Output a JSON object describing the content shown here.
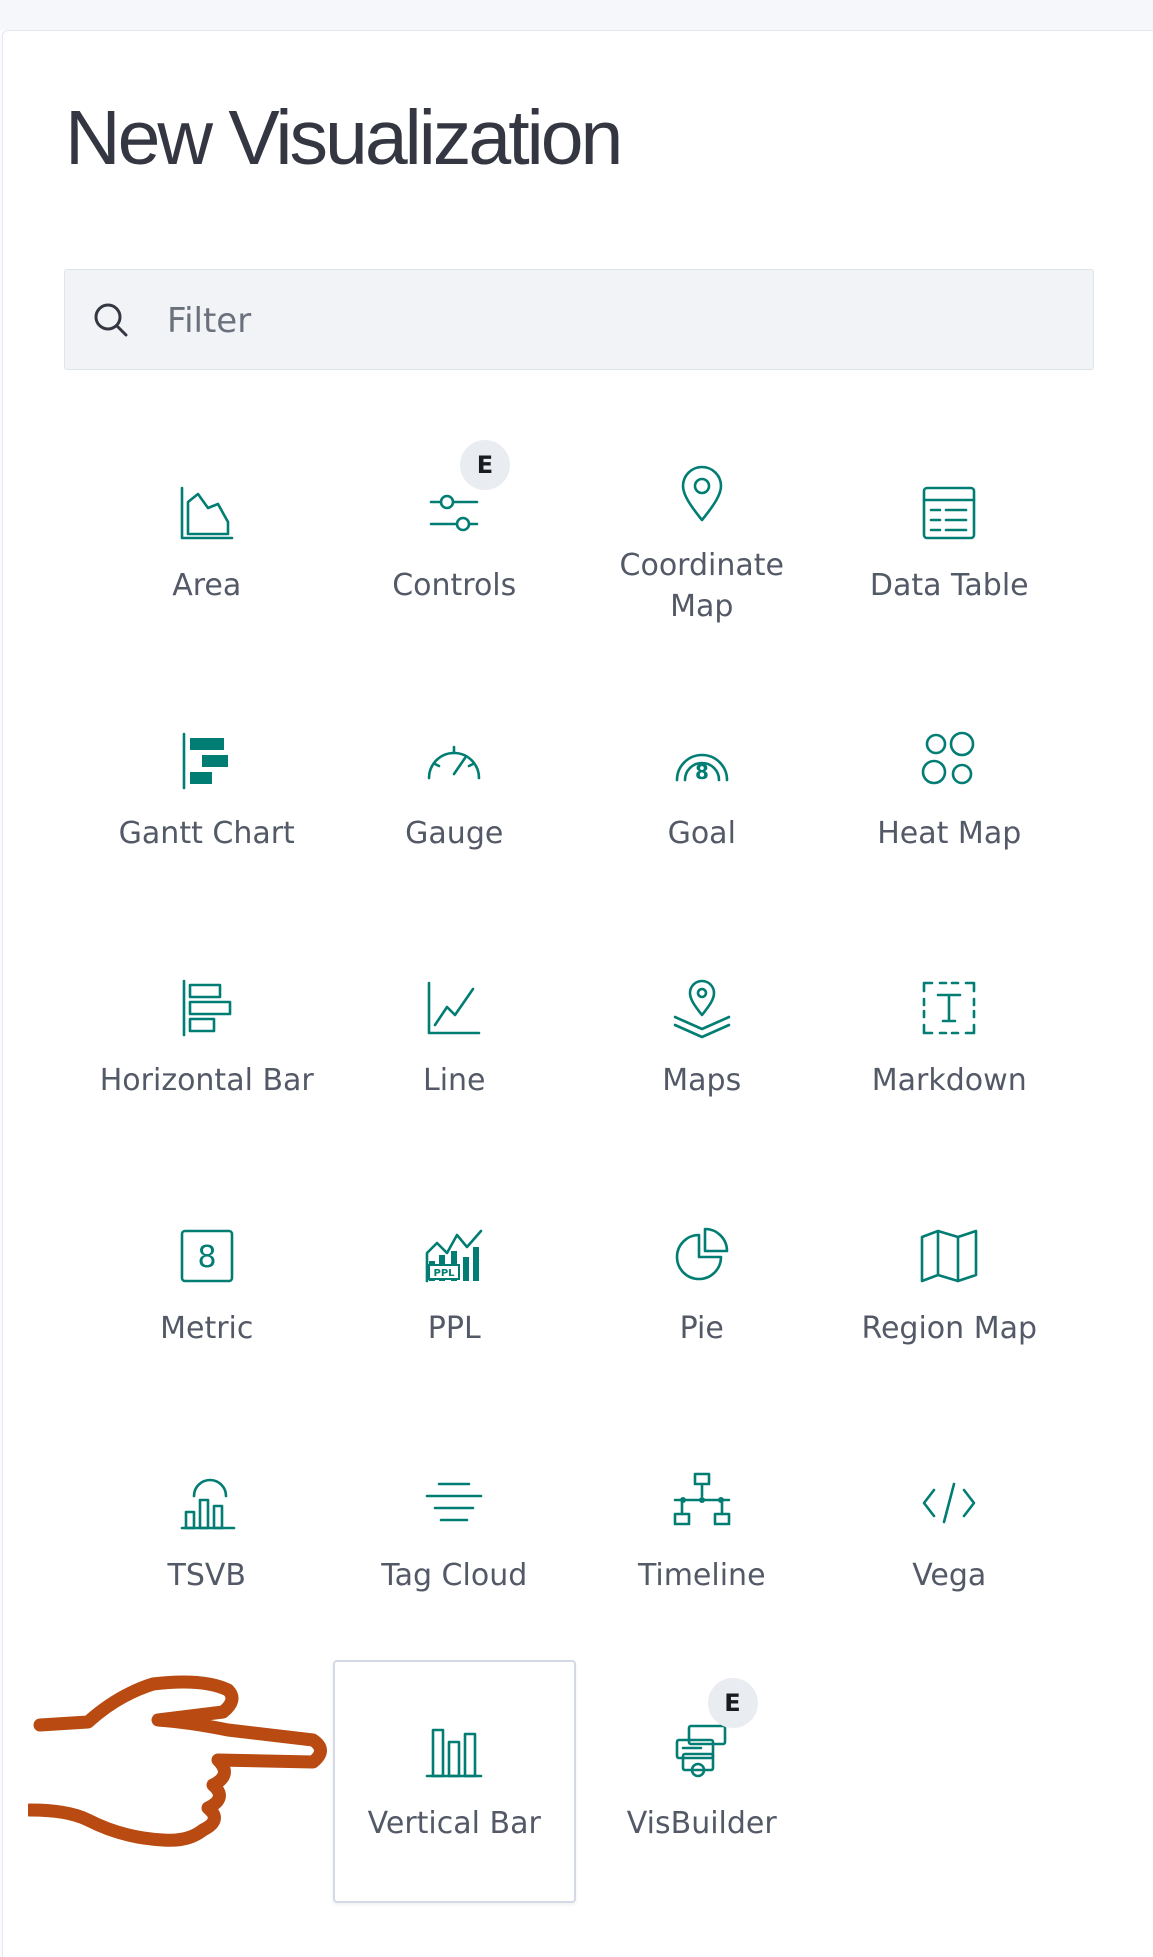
{
  "title": "New Visualization",
  "search": {
    "placeholder": "Filter",
    "value": ""
  },
  "colors": {
    "accent": "#017d73",
    "annotation": "#b84a12",
    "text": "#535966",
    "title": "#343741"
  },
  "visualizations": [
    {
      "label": "Area",
      "icon": "area-chart-icon"
    },
    {
      "label": "Controls",
      "icon": "controls-icon",
      "badge": "E"
    },
    {
      "label": "Coordinate\nMap",
      "icon": "map-pin-icon"
    },
    {
      "label": "Data Table",
      "icon": "table-icon"
    },
    {
      "label": "Gantt Chart",
      "icon": "gantt-chart-icon"
    },
    {
      "label": "Gauge",
      "icon": "gauge-icon"
    },
    {
      "label": "Goal",
      "icon": "goal-icon"
    },
    {
      "label": "Heat Map",
      "icon": "heat-map-icon"
    },
    {
      "label": "Horizontal Bar",
      "icon": "horizontal-bar-icon"
    },
    {
      "label": "Line",
      "icon": "line-chart-icon"
    },
    {
      "label": "Maps",
      "icon": "maps-icon"
    },
    {
      "label": "Markdown",
      "icon": "markdown-icon"
    },
    {
      "label": "Metric",
      "icon": "metric-icon"
    },
    {
      "label": "PPL",
      "icon": "ppl-icon"
    },
    {
      "label": "Pie",
      "icon": "pie-chart-icon"
    },
    {
      "label": "Region Map",
      "icon": "region-map-icon"
    },
    {
      "label": "TSVB",
      "icon": "tsvb-icon"
    },
    {
      "label": "Tag Cloud",
      "icon": "tag-cloud-icon"
    },
    {
      "label": "Timeline",
      "icon": "timeline-icon"
    },
    {
      "label": "Vega",
      "icon": "code-icon"
    },
    {
      "label": "",
      "icon": ""
    },
    {
      "label": "Vertical Bar",
      "icon": "vertical-bar-icon",
      "selected": true
    },
    {
      "label": "VisBuilder",
      "icon": "visbuilder-icon",
      "badge": "E"
    }
  ]
}
